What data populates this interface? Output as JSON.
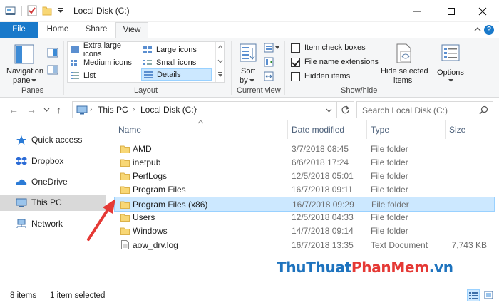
{
  "window": {
    "title": "Local Disk (C:)"
  },
  "ribbon_tabs": [
    "File",
    "Home",
    "Share",
    "View"
  ],
  "ribbon": {
    "panes": {
      "nav_pane_label": "Navigation",
      "nav_pane_label2": "pane",
      "group_label": "Panes"
    },
    "layout": {
      "items": [
        "Extra large icons",
        "Large icons",
        "Medium icons",
        "Small icons",
        "List",
        "Details"
      ],
      "selected": "Details",
      "group_label": "Layout"
    },
    "current_view": {
      "sort_label": "Sort",
      "sort_label2": "by",
      "group_label": "Current view"
    },
    "show_hide": {
      "item_check_boxes": "Item check boxes",
      "file_name_extensions": "File name extensions",
      "hidden_items": "Hidden items",
      "hide_selected_label": "Hide selected",
      "hide_selected_label2": "items",
      "group_label": "Show/hide",
      "item_check_boxes_checked": false,
      "file_name_extensions_checked": true,
      "hidden_items_checked": false
    },
    "options_label": "Options"
  },
  "address": {
    "crumbs": [
      "This PC",
      "Local Disk (C:)"
    ],
    "search_placeholder": "Search Local Disk (C:)"
  },
  "nav_pane": {
    "items": [
      "Quick access",
      "Dropbox",
      "OneDrive",
      "This PC",
      "Network"
    ],
    "selected": "This PC"
  },
  "file_list": {
    "columns": [
      "Name",
      "Date modified",
      "Type",
      "Size"
    ],
    "rows": [
      {
        "name": "AMD",
        "date": "3/7/2018 08:45",
        "type": "File folder",
        "size": ""
      },
      {
        "name": "inetpub",
        "date": "6/6/2018 17:24",
        "type": "File folder",
        "size": ""
      },
      {
        "name": "PerfLogs",
        "date": "12/5/2018 05:01",
        "type": "File folder",
        "size": ""
      },
      {
        "name": "Program Files",
        "date": "16/7/2018 09:11",
        "type": "File folder",
        "size": ""
      },
      {
        "name": "Program Files (x86)",
        "date": "16/7/2018 09:29",
        "type": "File folder",
        "size": ""
      },
      {
        "name": "Users",
        "date": "12/5/2018 04:33",
        "type": "File folder",
        "size": ""
      },
      {
        "name": "Windows",
        "date": "14/7/2018 09:14",
        "type": "File folder",
        "size": ""
      },
      {
        "name": "aow_drv.log",
        "date": "16/7/2018 13:35",
        "type": "Text Document",
        "size": "7,743 KB"
      }
    ],
    "selected_row": "Program Files (x86)"
  },
  "status": {
    "item_count": "8 items",
    "selection": "1 item selected"
  },
  "watermark": {
    "part1": "ThuThuat",
    "part2": "PhanMem",
    "part3": ".vn"
  },
  "colors": {
    "accent": "#1979ca",
    "selection_bg": "#cce8ff",
    "folder_yellow": "#f8d775",
    "arrow_red": "#e53935"
  }
}
